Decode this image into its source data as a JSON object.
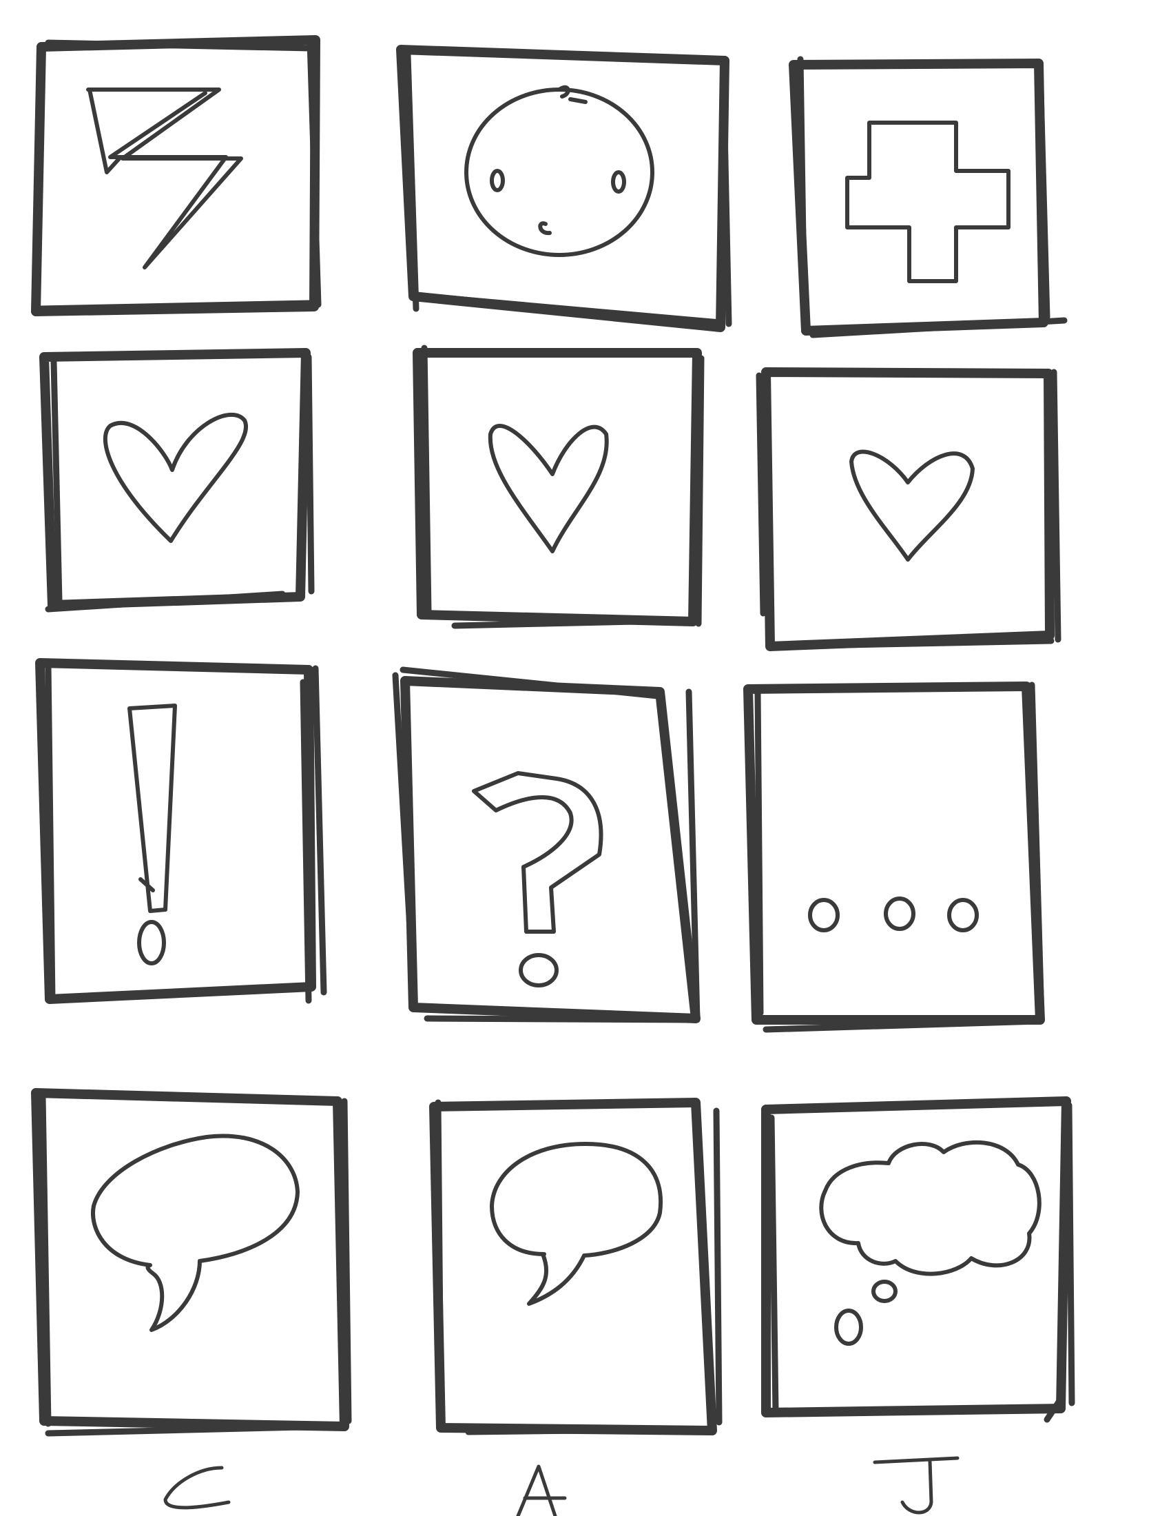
{
  "sheet": {
    "tiles": [
      {
        "icon": "lightning-bolt-icon"
      },
      {
        "icon": "baby-face-icon"
      },
      {
        "icon": "cross-icon"
      },
      {
        "icon": "heart-icon"
      },
      {
        "icon": "heart-icon"
      },
      {
        "icon": "heart-icon"
      },
      {
        "icon": "exclamation-icon"
      },
      {
        "icon": "question-mark-icon"
      },
      {
        "icon": "ellipsis-icon"
      },
      {
        "icon": "speech-bubble-icon"
      },
      {
        "icon": "speech-bubble-icon"
      },
      {
        "icon": "thought-bubble-icon"
      }
    ],
    "column_labels": [
      "C",
      "A",
      "J"
    ],
    "ink_color": "#3a3a3a"
  }
}
